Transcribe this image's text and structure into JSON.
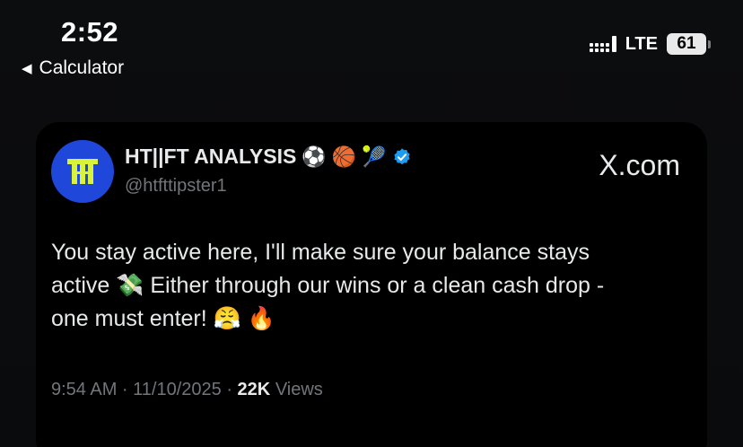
{
  "status_bar": {
    "time": "2:52",
    "back_app": "Calculator",
    "network": "LTE",
    "battery": "61"
  },
  "tweet": {
    "display_name": "HT||FT ANALYSIS",
    "name_emojis": [
      "⚽",
      "🏀",
      "🎾"
    ],
    "handle": "@htfttipster1",
    "source_logo": "X.com",
    "text_line1": "You stay active here, I'll make sure your balance stays",
    "text_line2a": "active",
    "text_line2_emoji": "💸",
    "text_line2b": "Either through our wins or a clean cash drop -",
    "text_line3": "one must enter!",
    "text_line3_emojis": "😤 🔥",
    "timestamp": "9:54 AM · 11/10/2025 ·",
    "views_count": "22K",
    "views_label": "Views",
    "avatar_monogram": "TT"
  },
  "colors": {
    "background": "#0b0c0e",
    "card": "#000000",
    "avatar": "#1f47d9",
    "avatar_mark": "#d9f23a",
    "verified": "#1d9bf0",
    "secondary_text": "#71767b"
  }
}
